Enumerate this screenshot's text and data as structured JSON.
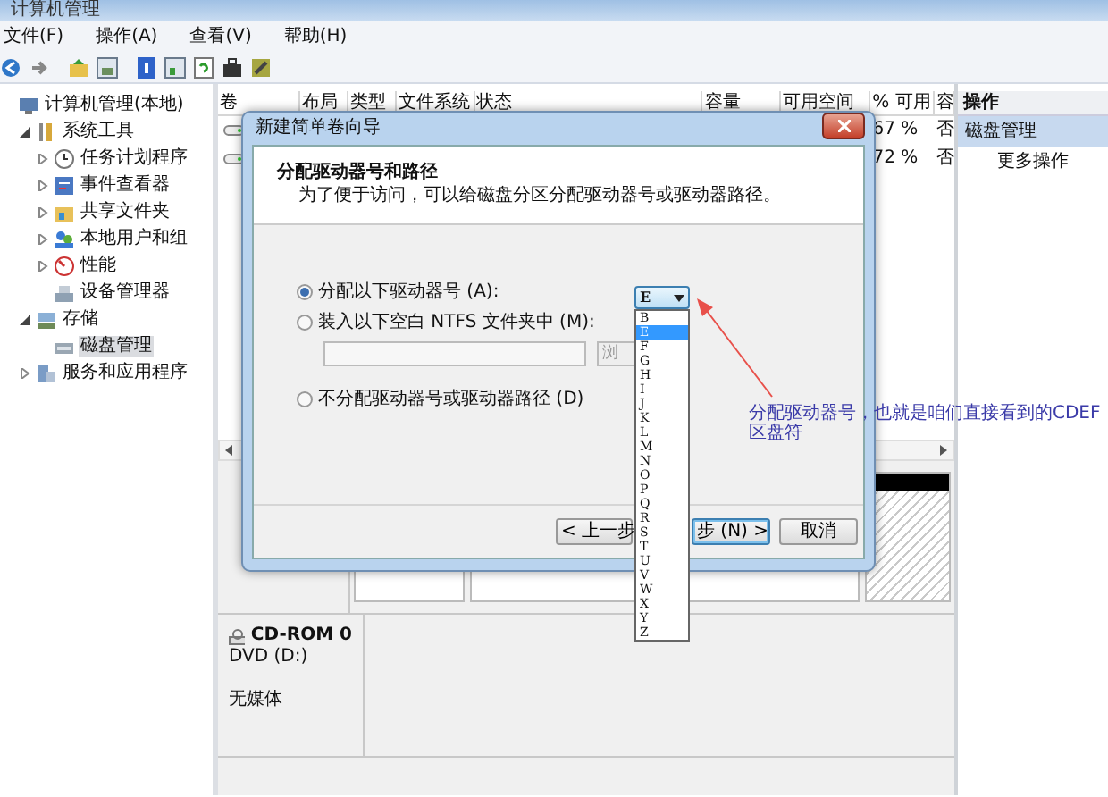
{
  "window": {
    "title": "计算机管理"
  },
  "menu": [
    {
      "label": "文件(F)"
    },
    {
      "label": "操作(A)"
    },
    {
      "label": "查看(V)"
    },
    {
      "label": "帮助(H)"
    }
  ],
  "tree": [
    {
      "label": "计算机管理(本地)",
      "selected": false,
      "children": [
        {
          "label": "系统工具",
          "expanded": true,
          "selected": false,
          "children": [
            {
              "label": "任务计划程序",
              "expanded": false,
              "selected": false
            },
            {
              "label": "事件查看器",
              "expanded": false,
              "selected": false
            },
            {
              "label": "共享文件夹",
              "expanded": false,
              "selected": false
            },
            {
              "label": "本地用户和组",
              "expanded": false,
              "selected": false
            },
            {
              "label": "性能",
              "expanded": false,
              "selected": false
            },
            {
              "label": "设备管理器",
              "selected": false
            }
          ]
        },
        {
          "label": "存储",
          "expanded": true,
          "selected": false,
          "children": [
            {
              "label": "磁盘管理",
              "selected": true
            }
          ]
        },
        {
          "label": "服务和应用程序",
          "expanded": false,
          "selected": false
        }
      ]
    }
  ],
  "volume_table": {
    "columns": [
      "卷",
      "布局",
      "类型",
      "文件系统",
      "状态",
      "容量",
      "可用空间",
      "% 可用",
      "容"
    ],
    "rows": [
      {
        "percent_free": "67 %",
        "column_9": "否"
      },
      {
        "percent_free": "72 %",
        "column_9": "否"
      }
    ]
  },
  "cdrom": {
    "name": "CD-ROM 0",
    "type": "DVD (D:)",
    "status": "无媒体"
  },
  "actions": {
    "header": "操作",
    "items": [
      {
        "label": "磁盘管理",
        "selected": true
      },
      {
        "label": "更多操作",
        "selected": false
      }
    ]
  },
  "dialog": {
    "title": "新建简单卷向导",
    "heading": "分配驱动器号和路径",
    "subtitle": "为了便于访问，可以给磁盘分区分配驱动器号或驱动器路径。",
    "options": [
      {
        "label": "分配以下驱动器号 (A):",
        "selected": true
      },
      {
        "label": "装入以下空白 NTFS 文件夹中 (M):",
        "selected": false
      },
      {
        "label": "不分配驱动器号或驱动器路径 (D)",
        "selected": false
      }
    ],
    "drive_letter": "E",
    "letters": [
      {
        "label": "B",
        "selected": false
      },
      {
        "label": "E",
        "selected": true
      },
      {
        "label": "F",
        "selected": false
      },
      {
        "label": "G",
        "selected": false
      },
      {
        "label": "H",
        "selected": false
      },
      {
        "label": "I",
        "selected": false
      },
      {
        "label": "J",
        "selected": false
      },
      {
        "label": "K",
        "selected": false
      },
      {
        "label": "L",
        "selected": false
      },
      {
        "label": "M",
        "selected": false
      },
      {
        "label": "N",
        "selected": false
      },
      {
        "label": "O",
        "selected": false
      },
      {
        "label": "P",
        "selected": false
      },
      {
        "label": "Q",
        "selected": false
      },
      {
        "label": "R",
        "selected": false
      },
      {
        "label": "S",
        "selected": false
      },
      {
        "label": "T",
        "selected": false
      },
      {
        "label": "U",
        "selected": false
      },
      {
        "label": "V",
        "selected": false
      },
      {
        "label": "W",
        "selected": false
      },
      {
        "label": "X",
        "selected": false
      },
      {
        "label": "Y",
        "selected": false
      },
      {
        "label": "Z",
        "selected": false
      }
    ],
    "browse": "浏",
    "buttons": {
      "back": "< 上一步",
      "next": "步 (N) >",
      "cancel": "取消"
    }
  },
  "annotation": {
    "lines": [
      "分配驱动器号，也就是咱们直接看到的CDEF",
      "区盘符"
    ]
  }
}
